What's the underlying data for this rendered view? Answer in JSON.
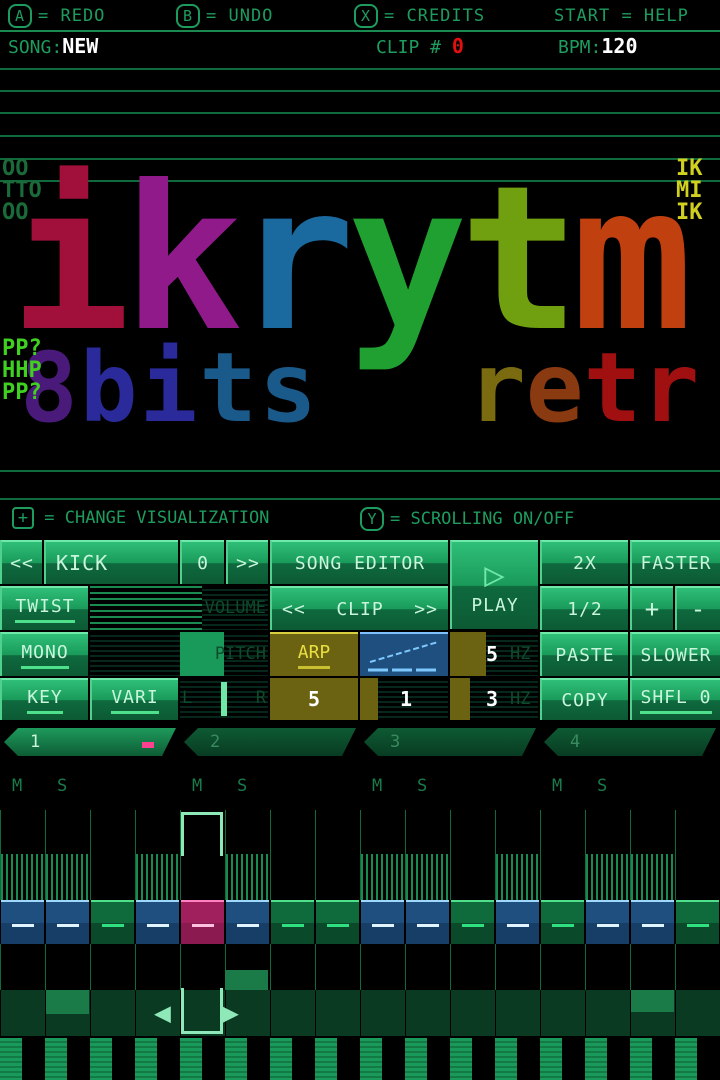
{
  "header": {
    "hints": [
      {
        "icon": "A",
        "label": "= REDO"
      },
      {
        "icon": "B",
        "label": "= UNDO"
      },
      {
        "icon": "X",
        "label": "= CREDITS"
      },
      {
        "icon": "START",
        "label": "= HELP"
      }
    ],
    "song_label": "SONG:",
    "song_value": "NEW",
    "clip_label": "CLIP #",
    "clip_value": "0",
    "bpm_label": "BPM:",
    "bpm_value": "120"
  },
  "visualization": {
    "logo": "ikrytm",
    "sublogo_left": "8bits",
    "sublogo_right": "retro",
    "left_glyphs": [
      "OO",
      "TTO",
      "OO",
      "PP?",
      "HHP",
      "PP?"
    ],
    "right_glyphs": [
      "IK",
      "MI",
      "IK"
    ]
  },
  "hints2": [
    {
      "icon": "dpad-icon",
      "label": "= CHANGE VISUALIZATION"
    },
    {
      "icon": "Y",
      "label": "= SCROLLING ON/OFF"
    }
  ],
  "controls": {
    "prev": "<<",
    "instrument": "KICK",
    "instrument_index": "0",
    "next": ">>",
    "song_editor": "SONG EDITOR",
    "play": "PLAY",
    "double": "2X",
    "faster": "FASTER",
    "twist": "TWIST",
    "volume": "VOLUME",
    "clip": "CLIP",
    "clip_prev": "<<",
    "clip_next": ">>",
    "half": "1/2",
    "plus": "+",
    "minus": "-",
    "mono": "MONO",
    "pitch": "PITCH",
    "arp": "ARP",
    "arp_rate": "5",
    "hz2": "HZ",
    "paste": "PASTE",
    "slower": "SLOWER",
    "key": "KEY",
    "vari": "VARI",
    "pan_l": "L",
    "pan_r": "R",
    "val1": "5",
    "val2": "1",
    "val3": "3",
    "hz1": "HZ",
    "copy": "COPY",
    "shuffle": "SHFL 0"
  },
  "tracks": [
    {
      "label": "1",
      "active": true
    },
    {
      "label": "2"
    },
    {
      "label": "3"
    },
    {
      "label": "4"
    }
  ],
  "sequencer": {
    "mute": "M",
    "solo": "S",
    "steps": [
      "blue",
      "blue",
      "green",
      "blue",
      "pink",
      "blue",
      "green",
      "green",
      "blue",
      "blue",
      "green",
      "blue",
      "green",
      "blue",
      "blue",
      "green"
    ],
    "selected_step": 5
  },
  "colors": {
    "accent": "#1fa865",
    "blue": "#1e4f7e",
    "pink": "#a0205e",
    "yellow": "#6b6212",
    "clip_value": "#e01010"
  }
}
